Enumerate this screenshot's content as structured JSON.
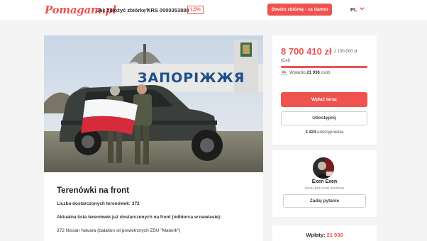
{
  "header": {
    "logo": "Pomagam.pl",
    "how_to_link": "Jak założyć zbiórkę?",
    "krs_label": "KRS 0000353888",
    "krs_badge": "1,5%",
    "create_button": "Stwórz zbiórkę - za darmo",
    "language": "PL"
  },
  "campaign": {
    "title": "Terenówki na front",
    "delivered_label": "Liczba dostarczonych terenówek: 372",
    "list_label": "Aktualna lista terenówek już dostarczonych na front (odbiorca w nawiasie):",
    "list_first_item": "372 Nissan Navara (batalion sił powietrznych ZSU \"Materik\")",
    "photo_sign_text": "ЗАПОРІЖЖЯ"
  },
  "donation": {
    "amount": "8 700 410 zł",
    "goal": "z 100 000 zł",
    "goal_label": "(Cel)",
    "progress_fraction": 1.0,
    "supporters_prefix": "Wpłaciło",
    "supporters_count": "21 938",
    "supporters_suffix": "osób",
    "pay_button": "Wpłać teraz",
    "share_button": "Udostępnij",
    "shares_count": "3 424",
    "shares_label": "udostępnienia"
  },
  "organizer": {
    "name": "Exen Exen",
    "role": "ORGANIZATOR ZBIÓRKI",
    "ask_button": "Zadaj pytanie"
  },
  "payments": {
    "label": "Wpłaty:",
    "count": "21 938"
  },
  "colors": {
    "brand": "#ef5350",
    "progress_track": "#f5c7c6",
    "background": "#f4f4f4"
  }
}
